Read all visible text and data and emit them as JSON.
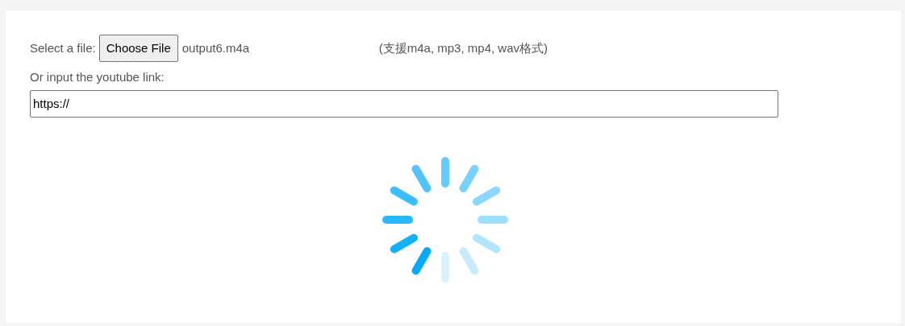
{
  "file_picker": {
    "label": "Select a file:",
    "button": "Choose File",
    "file_name": "output6.m4a",
    "hint": "(支援m4a, mp3, mp4, wav格式)"
  },
  "youtube_link": {
    "label": "Or input the youtube link:",
    "value": "https://"
  }
}
